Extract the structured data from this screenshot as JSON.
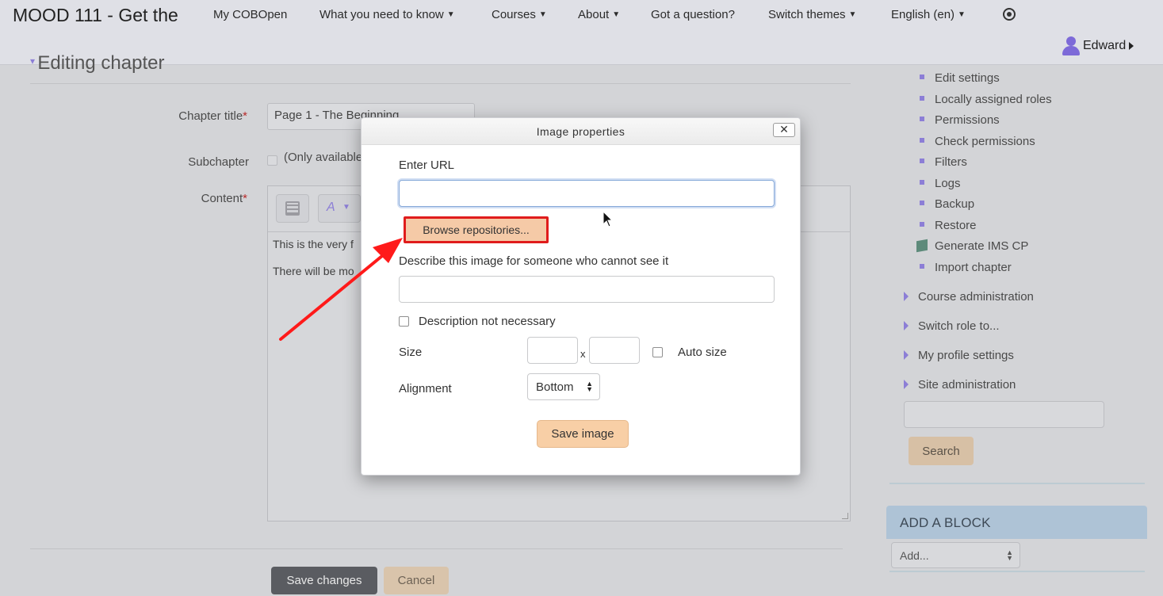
{
  "navbar": {
    "brand": "MOOD 111 - Get the",
    "items": [
      {
        "label": "My COBOpen",
        "caret": false
      },
      {
        "label": "What you need to know",
        "caret": true
      },
      {
        "label": "Courses",
        "caret": true
      },
      {
        "label": "About",
        "caret": true
      },
      {
        "label": "Got a question?",
        "caret": false
      },
      {
        "label": "Switch themes",
        "caret": true
      },
      {
        "label": "English (en)",
        "caret": true
      }
    ],
    "user_name": "Edward"
  },
  "form": {
    "heading": "Editing chapter",
    "chapter_title_label": "Chapter title",
    "chapter_title_value": "Page 1 - The Beginning",
    "subchapter_label": "Subchapter",
    "subchapter_note": "(Only available",
    "content_label": "Content",
    "required_mark": "*",
    "content_lines": [
      "This is the very f",
      "There will be mo"
    ],
    "save_changes": "Save changes",
    "cancel": "Cancel"
  },
  "sidebar": {
    "links": [
      "Edit settings",
      "Locally assigned roles",
      "Permissions",
      "Check permissions",
      "Filters",
      "Logs",
      "Backup",
      "Restore",
      "Generate IMS CP",
      "Import chapter"
    ],
    "groups": [
      "Course administration",
      "Switch role to...",
      "My profile settings",
      "Site administration"
    ],
    "search_button": "Search",
    "add_block_header": "ADD A BLOCK",
    "add_block_select": "Add..."
  },
  "dialog": {
    "title": "Image properties",
    "close": "✕",
    "url_label": "Enter URL",
    "url_value": "",
    "browse_button": "Browse repositories...",
    "describe_label": "Describe this image for someone who cannot see it",
    "describe_value": "",
    "desc_not_necessary": "Description not necessary",
    "size_label": "Size",
    "size_x": "x",
    "auto_size": "Auto size",
    "alignment_label": "Alignment",
    "alignment_value": "Bottom",
    "save_image": "Save image"
  },
  "colors": {
    "highlight_border": "#e01c1c",
    "annotation_arrow": "#ff1a1a",
    "accent_button": "#f8cfa6",
    "sidebar_accent": "#8c7ed6"
  }
}
